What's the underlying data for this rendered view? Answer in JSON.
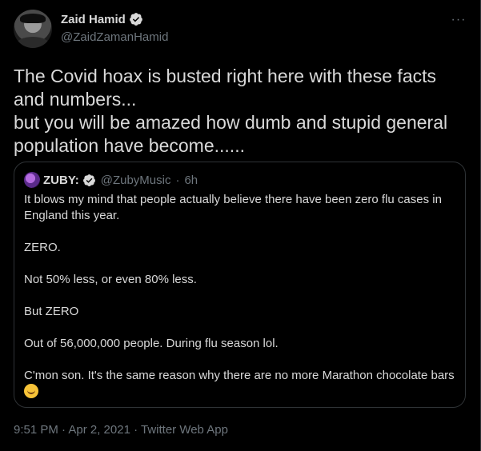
{
  "author": {
    "name": "Zaid Hamid",
    "handle": "@ZaidZamanHamid",
    "avatar_icon": "profile-photo",
    "verified_icon": "verified-badge-icon"
  },
  "more_label": "···",
  "tweet_text": "The Covid hoax is busted right here with these facts and numbers...\nbut you will be amazed how dumb and stupid general population have become......",
  "quoted": {
    "name": "ZUBY:",
    "handle": "@ZubyMusic",
    "separator": "·",
    "time": "6h",
    "body": "It blows my mind that people actually believe there have been zero flu cases in England this year.\n\nZERO.\n\nNot 50% less, or even 80% less.\n\nBut ZERO\n\nOut of 56,000,000 people. During flu season lol.\n\nC'mon son. It's the same reason why there are no more Marathon chocolate bars",
    "emoji_icon": "rolling-on-floor-laughing-emoji"
  },
  "footer": {
    "timestamp": "9:51 PM · Apr 2, 2021 · Twitter Web App"
  },
  "colors": {
    "background": "#000000",
    "text": "#d9d9d9",
    "muted": "#6e767d",
    "border": "#2f3336"
  }
}
